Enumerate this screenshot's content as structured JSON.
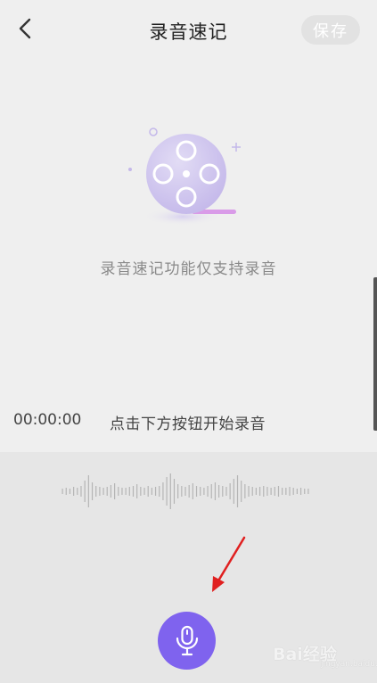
{
  "header": {
    "back_icon": "chevron-left-icon",
    "title": "录音速记",
    "save_label": "保存"
  },
  "empty_state": {
    "illustration_icon": "film-reel-icon",
    "message": "录音速记功能仅支持录音"
  },
  "recorder": {
    "timer": "00:00:00",
    "hint": "点击下方按钮开始录音",
    "mic_icon": "microphone-icon"
  },
  "watermark": {
    "text": "Bai经验",
    "sub": "jingyan.baidu.com"
  },
  "colors": {
    "accent": "#7f63ee",
    "background": "#efefef",
    "panel": "#e6e6e6",
    "annotation_arrow": "#e02020"
  }
}
